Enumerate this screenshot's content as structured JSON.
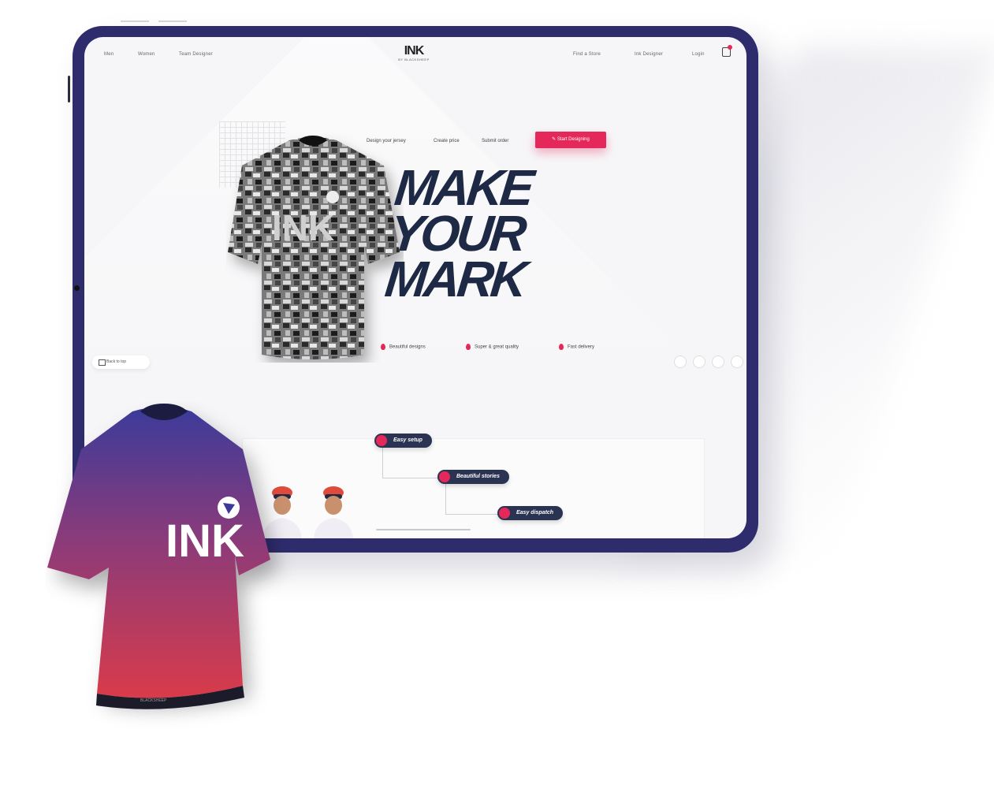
{
  "nav": {
    "left_links": [
      "Men",
      "Women",
      "Team Designer"
    ],
    "right_links": [
      "Find a Store",
      "Ink Designer",
      "Login"
    ],
    "logo": "INK",
    "logo_sub": "BY BLACKSHEEP"
  },
  "subnav": {
    "links": [
      "Design your jersey",
      "Create price",
      "Submit order"
    ],
    "cta_label": "Start Designing"
  },
  "hero": {
    "line1": "MAKE",
    "line2": "YOUR",
    "line3": "MARK"
  },
  "features": [
    "Beautiful designs",
    "Super & great quality",
    "Fast delivery"
  ],
  "pill_left": "Back to top",
  "tags": [
    "Easy setup",
    "Beautiful stories",
    "Easy dispatch"
  ],
  "jersey_front_text": "INK",
  "jersey_hem_text": "BLACKSHEEP",
  "colors": {
    "frame": "#2f2c6e",
    "accent": "#e5285a",
    "headline": "#1e2a45",
    "tag_bg": "#2a3352"
  }
}
